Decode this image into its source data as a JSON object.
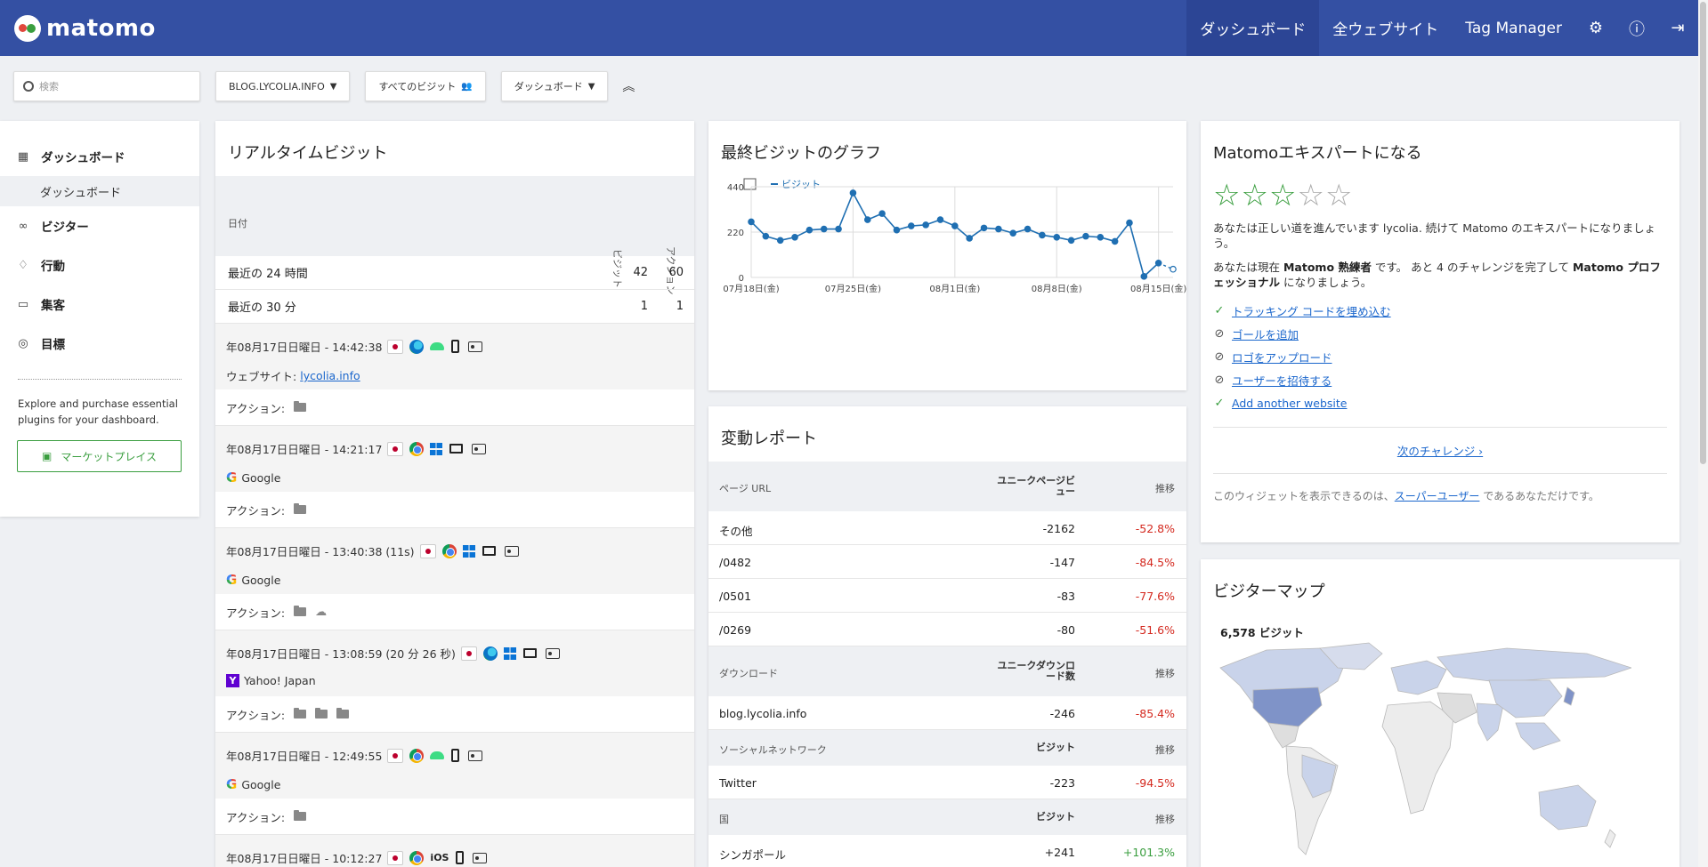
{
  "app": {
    "brand": "matomo"
  },
  "topnav": {
    "dashboard": "ダッシュボード",
    "all_websites": "全ウェブサイト",
    "tag_manager": "Tag Manager"
  },
  "toolbar": {
    "search_placeholder": "検索",
    "site": "BLOG.LYCOLIA.INFO",
    "segment": "すべてのビジット",
    "dashboard": "ダッシュボード"
  },
  "sidebar": {
    "items": [
      {
        "label": "ダッシュボード",
        "icon": "grid-icon"
      },
      {
        "label": "ビジター",
        "icon": "visitors-icon"
      },
      {
        "label": "行動",
        "icon": "bell-icon"
      },
      {
        "label": "集客",
        "icon": "acquisition-icon"
      },
      {
        "label": "目標",
        "icon": "target-icon"
      }
    ],
    "sub_active": "ダッシュボード",
    "promo": "Explore and purchase essential plugins for your dashboard.",
    "market_button": "マーケットプレイス"
  },
  "realtime": {
    "title": "リアルタイムビジット",
    "headers": {
      "date": "日付",
      "visits": "ビジット",
      "actions": "アクション"
    },
    "summary": [
      {
        "label": "最近の 24 時間",
        "visits": "42",
        "actions": "60"
      },
      {
        "label": "最近の 30 分",
        "visits": "1",
        "actions": "1"
      }
    ],
    "visits": [
      {
        "time": "年08月17日日曜日 - 14:42:38",
        "source_prefix": "ウェブサイト:",
        "source": "lycolia.info",
        "actions_label": "アクション:"
      },
      {
        "time": "年08月17日日曜日 - 14:21:17",
        "source": "Google",
        "actions_label": "アクション:"
      },
      {
        "time": "年08月17日日曜日 - 13:40:38 (11s)",
        "source": "Google",
        "actions_label": "アクション:"
      },
      {
        "time": "年08月17日日曜日 - 13:08:59 (20 分 26 秒)",
        "source": "Yahoo! Japan",
        "actions_label": "アクション:"
      },
      {
        "time": "年08月17日日曜日 - 12:49:55",
        "source": "Google",
        "actions_label": "アクション:"
      },
      {
        "time": "年08月17日日曜日 - 10:12:27",
        "os_label": "iOS"
      }
    ]
  },
  "graph": {
    "title": "最終ビジットのグラフ",
    "legend": "ビジット"
  },
  "chart_data": {
    "type": "line",
    "title": "最終ビジットのグラフ",
    "series": [
      {
        "name": "ビジット",
        "values": [
          270,
          200,
          180,
          195,
          230,
          235,
          235,
          410,
          280,
          310,
          230,
          250,
          255,
          280,
          250,
          190,
          240,
          235,
          215,
          235,
          205,
          195,
          180,
          200,
          195,
          175,
          265,
          5,
          70,
          40
        ]
      }
    ],
    "xtick_labels": [
      "07月18日(金)",
      "07月25日(金)",
      "08月1日(金)",
      "08月8日(金)",
      "08月15日(金)"
    ],
    "ytick_labels": [
      "0",
      "220",
      "440"
    ],
    "ylim": [
      0,
      440
    ],
    "grid": true
  },
  "changes": {
    "title": "変動レポート",
    "sections": [
      {
        "header": [
          "ページ URL",
          "ユニークページビュー",
          "推移"
        ],
        "rows": [
          [
            "その他",
            "-2162",
            "-52.8%"
          ],
          [
            "/0482",
            "-147",
            "-84.5%"
          ],
          [
            "/0501",
            "-83",
            "-77.6%"
          ],
          [
            "/0269",
            "-80",
            "-51.6%"
          ]
        ]
      },
      {
        "header": [
          "ダウンロード",
          "ユニークダウンロード数",
          "推移"
        ],
        "rows": [
          [
            "blog.lycolia.info",
            "-246",
            "-85.4%"
          ]
        ]
      },
      {
        "header": [
          "ソーシャルネットワーク",
          "ビジット",
          "推移"
        ],
        "rows": [
          [
            "Twitter",
            "-223",
            "-94.5%"
          ]
        ]
      },
      {
        "header": [
          "国",
          "ビジット",
          "推移"
        ],
        "rows": [
          [
            "シンガポール",
            "+241",
            "+101.3%"
          ]
        ]
      }
    ]
  },
  "expert": {
    "title": "Matomoエキスパートになる",
    "rating": {
      "filled": 3,
      "total": 5
    },
    "p1": "あなたは正しい道を進んでいます lycolia. 続けて Matomo のエキスパートになりましょう。",
    "p2_a": "あなたは現在 ",
    "p2_b": "Matomo 熟練者",
    "p2_c": " です。 あと 4 のチャレンジを完了して ",
    "p2_d": "Matomo プロフェッショナル",
    "p2_e": " になりましょう。",
    "challenges": [
      {
        "label": "トラッキング コードを埋め込む",
        "done": true
      },
      {
        "label": "ゴールを追加",
        "done": false
      },
      {
        "label": "ロゴをアップロード",
        "done": false
      },
      {
        "label": "ユーザーを招待する",
        "done": false
      },
      {
        "label": "Add another website",
        "done": true
      }
    ],
    "next": "次のチャレンジ ›",
    "foot_a": "このウィジェットを表示できるのは、",
    "foot_link": "スーパーユーザー",
    "foot_b": " であるあなただけです。"
  },
  "map": {
    "title": "ビジターマップ",
    "count": "6,578 ビジット"
  }
}
